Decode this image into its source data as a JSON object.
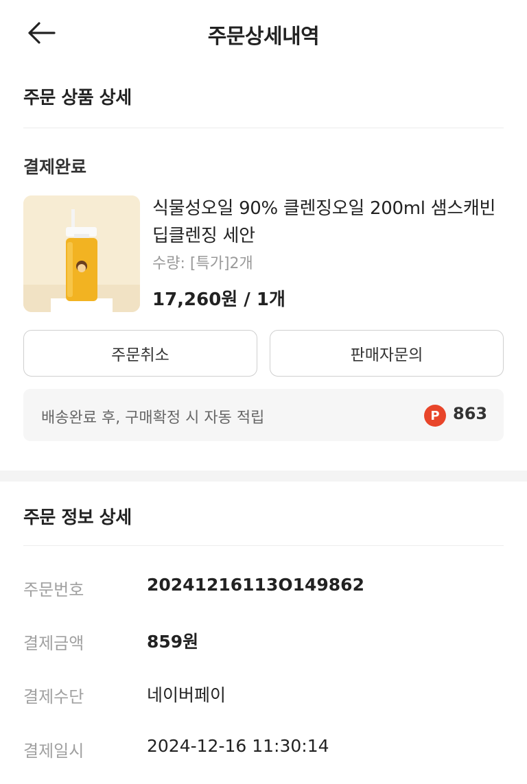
{
  "header": {
    "title": "주문상세내역",
    "back_icon": "arrow-left-icon"
  },
  "order_product": {
    "section_title": "주문 상품 상세",
    "status": "결제완료",
    "product": {
      "name": "식물성오일 90% 클렌징오일 200ml 샘스캐빈 딥클렌징 세안",
      "quantity": "수량: [특가]2개",
      "price": "17,260원 / 1개"
    },
    "buttons": {
      "cancel": "주문취소",
      "inquiry": "판매자문의"
    },
    "points": {
      "text": "배송완료 후, 구매확정 시 자동 적립",
      "badge": "P",
      "value": "863",
      "color": "#e8452a"
    }
  },
  "order_info": {
    "section_title": "주문 정보 상세",
    "rows": [
      {
        "label": "주문번호",
        "value": "20241216113O149862"
      },
      {
        "label": "결제금액",
        "value": "859원"
      },
      {
        "label": "결제수단",
        "value": "네이버페이"
      },
      {
        "label": "결제일시",
        "value": "2024-12-16 11:30:14"
      }
    ]
  }
}
